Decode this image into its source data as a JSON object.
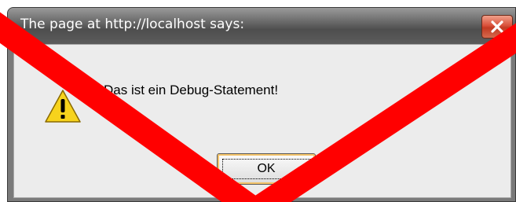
{
  "window": {
    "title": "The page at http://localhost says:"
  },
  "dialog": {
    "message": "Das ist ein Debug-Statement!",
    "icon": "warning-icon",
    "ok_label": "OK"
  },
  "overlay": {
    "type": "red-x-cross",
    "color": "#ff0000"
  }
}
